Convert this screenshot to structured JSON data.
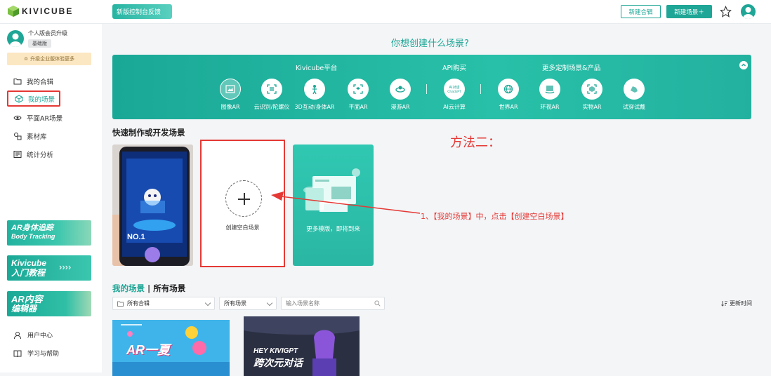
{
  "header": {
    "logo_text": "KIVICUBE",
    "feedback_label": "新版控制台反馈",
    "new_collection_label": "新建合辑",
    "new_scene_label": "新建场景＋"
  },
  "sidebar": {
    "profile_name": "个人版会员升级",
    "profile_badge": "基础版",
    "upgrade_text": "升级企业版体验更多",
    "nav": [
      {
        "label": "我的合辑",
        "icon": "folder-icon"
      },
      {
        "label": "我的场景",
        "icon": "cube-icon",
        "active": true
      },
      {
        "label": "平面AR场景",
        "icon": "eye-icon"
      },
      {
        "label": "素材库",
        "icon": "assets-icon"
      },
      {
        "label": "统计分析",
        "icon": "stats-icon"
      }
    ],
    "banners": [
      {
        "line1": "AR身体追踪",
        "line2": "Body Tracking"
      },
      {
        "line1": "Kivicube",
        "line2": "入门教程"
      },
      {
        "line1": "AR内容",
        "line2": "编辑器"
      }
    ],
    "bottom": [
      {
        "label": "用户中心",
        "icon": "user-icon"
      },
      {
        "label": "学习与帮助",
        "icon": "book-icon"
      }
    ]
  },
  "main": {
    "title": "你想创建什么场景?",
    "panel": {
      "groups": [
        "Kivicube平台",
        "API购买",
        "更多定制场景&产品"
      ],
      "items": [
        {
          "label": "图像AR",
          "selected": true
        },
        {
          "label": "云识别/陀螺仪"
        },
        {
          "label": "3D互动/身体AR"
        },
        {
          "label": "平面AR"
        },
        {
          "label": "漫游AR"
        },
        {
          "label": "AI云计算"
        },
        {
          "label": "世界AR"
        },
        {
          "label": "环视AR"
        },
        {
          "label": "实物AR"
        },
        {
          "label": "试穿试戴"
        }
      ]
    },
    "quick_title": "快速制作或开发场景",
    "cards": {
      "blank_label": "创建空白场景",
      "more_label": "更多模版，即将到来",
      "phone_text": "NO.1"
    },
    "annotation": {
      "method": "方法二：",
      "step": "1、【我的场景】中，点击【创建空白场景】"
    },
    "list": {
      "title_a": "我的场景",
      "title_sep": "|",
      "title_b": "所有场景",
      "filter_collection": "所有合辑",
      "filter_scene": "所有场景",
      "search_placeholder": "输入场景名称",
      "sort_label": "更新时间",
      "thumbs": [
        {
          "text": "AR一夏"
        },
        {
          "text_top": "HEY KIVIGPT",
          "text_bottom": "跨次元对话"
        }
      ]
    }
  },
  "colors": {
    "accent": "#1fa696",
    "annotation_red": "#e53935"
  }
}
